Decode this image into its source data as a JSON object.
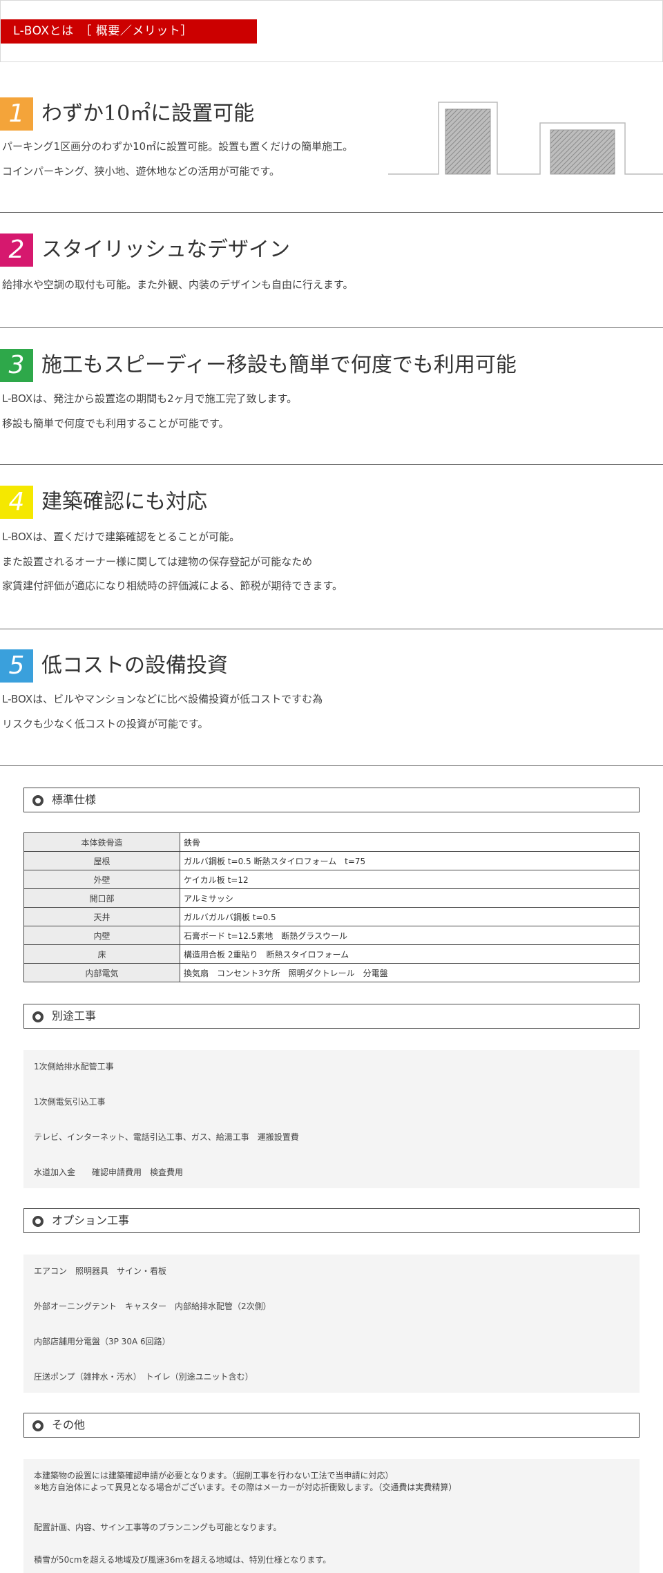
{
  "header": {
    "title": "L-BOXとは　［ 概要／メリット］"
  },
  "colors": {
    "red": "#cc0000",
    "orange": "#f4a43a",
    "magenta": "#d6186e",
    "green": "#2ea84a",
    "yellow": "#f5e800",
    "blue": "#3aa0dc"
  },
  "features": [
    {
      "num": "1",
      "heading": "わずか10㎡に設置可能",
      "lines": [
        "パーキング1区画分のわずか10㎡に設置可能。設置も置くだけの簡単施工。",
        "コインパーキング、狭小地、遊休地などの活用が可能です。"
      ]
    },
    {
      "num": "2",
      "heading": "スタイリッシュなデザイン",
      "lines": [
        "給排水や空調の取付も可能。また外観、内装のデザインも自由に行えます。"
      ]
    },
    {
      "num": "3",
      "heading": "施工もスピーディー移設も簡単で何度でも利用可能",
      "lines": [
        "L-BOXは、発注から設置迄の期間も2ヶ月で施工完了致します。",
        "移設も簡単で何度でも利用することが可能です。"
      ]
    },
    {
      "num": "4",
      "heading": "建築確認にも対応",
      "lines": [
        "L-BOXは、置くだけで建築確認をとることが可能。",
        "また設置されるオーナー様に関しては建物の保存登記が可能なため",
        "家賃建付評価が適応になり相続時の評価減による、節税が期待できます。"
      ]
    },
    {
      "num": "5",
      "heading": "低コストの設備投資",
      "lines": [
        "L-BOXは、ビルやマンションなどに比べ設備投資が低コストですむ為",
        "リスクも少なく低コストの投資が可能です。"
      ]
    }
  ],
  "spec": {
    "title": "標準仕様",
    "rows": [
      {
        "k": "本体鉄骨造",
        "v": "鉄骨"
      },
      {
        "k": "屋根",
        "v": "ガルバ鋼板 t=0.5 断熱スタイロフォーム　t=75"
      },
      {
        "k": "外壁",
        "v": "ケイカル板 t=12"
      },
      {
        "k": "開口部",
        "v": "アルミサッシ"
      },
      {
        "k": "天井",
        "v": "ガルバガルバ鋼板 t=0.5"
      },
      {
        "k": "内壁",
        "v": "石膏ボード t=12.5素地　断熱グラスウール"
      },
      {
        "k": "床",
        "v": "構造用合板 2重貼り　断熱スタイロフォーム"
      },
      {
        "k": "内部電気",
        "v": "換気扇　コンセント3ケ所　照明ダクトレール　分電盤"
      }
    ]
  },
  "separate": {
    "title": "別途工事",
    "items": [
      "1次側給排水配管工事",
      "1次側電気引込工事",
      "テレビ、インターネット、電話引込工事、ガス、給湯工事　運搬設置費",
      "水道加入金　　確認申請費用　検査費用"
    ]
  },
  "option": {
    "title": "オプション工事",
    "items": [
      "エアコン　照明器具　サイン・看板",
      "外部オーニングテント　キャスター　内部給排水配管（2次側）",
      "内部店舗用分電盤（3P 30A 6回路）",
      "圧送ポンプ（雑排水・汚水）　トイレ（別途ユニット含む）"
    ]
  },
  "other": {
    "title": "その他",
    "items": [
      "本建築物の設置には建築確認申請が必要となります。（掘削工事を行わない工法で当申請に対応）",
      "※地方自治体によって異見となる場合がございます。その際はメーカーが対応折衝致します。（交通費は実費精算）",
      "配置計画、内容、サイン工事等のプランニングも可能となります。",
      "積雪が50cmを超える地域及び風速36mを超える地域は、特別仕様となります。"
    ]
  }
}
